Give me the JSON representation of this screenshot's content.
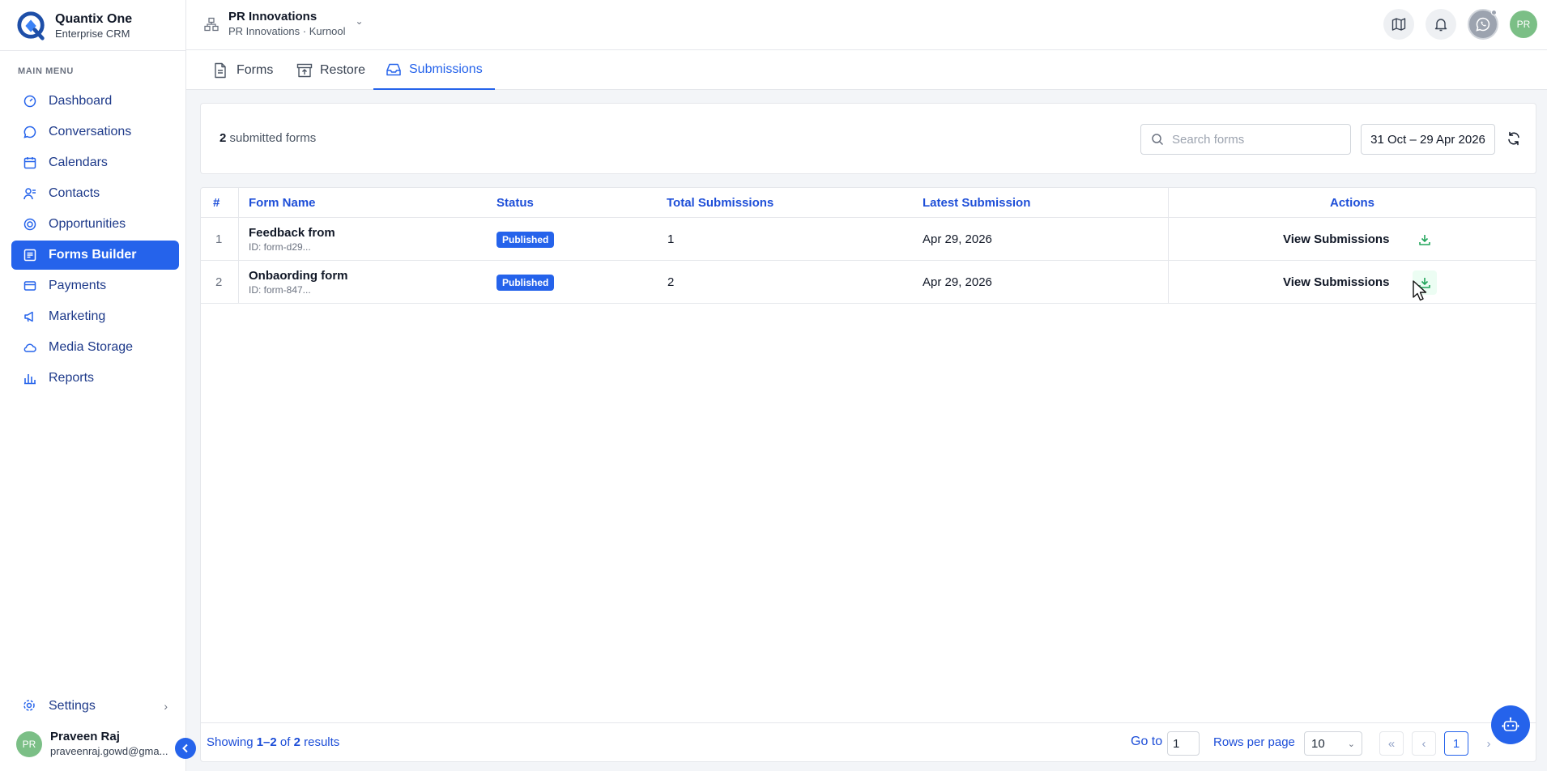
{
  "brand": {
    "name": "Quantix One",
    "subtitle": "Enterprise CRM"
  },
  "sidebar": {
    "heading": "MAIN MENU",
    "items": [
      {
        "label": "Dashboard",
        "icon": "gauge-icon"
      },
      {
        "label": "Conversations",
        "icon": "chat-icon"
      },
      {
        "label": "Calendars",
        "icon": "calendar-icon"
      },
      {
        "label": "Contacts",
        "icon": "contacts-icon"
      },
      {
        "label": "Opportunities",
        "icon": "target-icon"
      },
      {
        "label": "Forms Builder",
        "icon": "form-icon",
        "active": true
      },
      {
        "label": "Payments",
        "icon": "card-icon"
      },
      {
        "label": "Marketing",
        "icon": "megaphone-icon"
      },
      {
        "label": "Media Storage",
        "icon": "cloud-icon"
      },
      {
        "label": "Reports",
        "icon": "bar-chart-icon"
      }
    ],
    "settings_label": "Settings",
    "user": {
      "initials": "PR",
      "name": "Praveen Raj",
      "email": "praveenraj.gowd@gma..."
    }
  },
  "topbar": {
    "org_name": "PR Innovations",
    "org_sub": "PR Innovations · Kurnool",
    "avatar_initials": "PR"
  },
  "tabs": [
    {
      "label": "Forms",
      "icon": "document-icon"
    },
    {
      "label": "Restore",
      "icon": "archive-icon"
    },
    {
      "label": "Submissions",
      "icon": "inbox-icon",
      "active": true
    }
  ],
  "filter": {
    "count": "2",
    "count_suffix": "submitted forms",
    "search_placeholder": "Search forms",
    "date_range": "31 Oct – 29 Apr 2026"
  },
  "table": {
    "columns": [
      "#",
      "Form Name",
      "Status",
      "Total Submissions",
      "Latest Submission",
      "Actions"
    ],
    "rows": [
      {
        "index": "1",
        "name": "Feedback from",
        "id": "ID: form-d29...",
        "status": "Published",
        "total": "1",
        "latest": "Apr 29, 2026",
        "action": "View Submissions"
      },
      {
        "index": "2",
        "name": "Onbaording form",
        "id": "ID: form-847...",
        "status": "Published",
        "total": "2",
        "latest": "Apr 29, 2026",
        "action": "View Submissions"
      }
    ]
  },
  "footer": {
    "showing_prefix": "Showing ",
    "showing_range": "1–2",
    "showing_of": " of ",
    "showing_total": "2",
    "showing_suffix": " results",
    "goto_label": "Go to",
    "goto_value": "1",
    "rows_per_page_label": "Rows per page",
    "rows_per_page_value": "10",
    "current_page": "1"
  },
  "colors": {
    "accent": "#2563eb",
    "download": "#22a55b"
  }
}
